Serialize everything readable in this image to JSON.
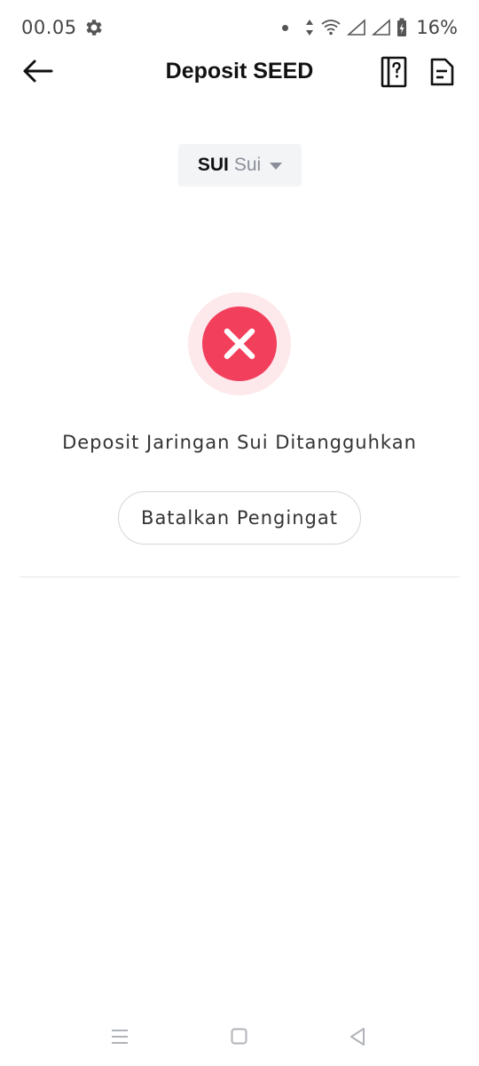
{
  "status_bar": {
    "time": "00.05",
    "battery": "16%"
  },
  "header": {
    "title": "Deposit SEED"
  },
  "coin_selector": {
    "symbol": "SUI",
    "name": "Sui"
  },
  "status": {
    "message": "Deposit Jaringan Sui Ditangguhkan",
    "action_label": "Batalkan Pengingat"
  },
  "colors": {
    "error_red": "#f23f5c",
    "error_halo": "#fde8ec"
  }
}
